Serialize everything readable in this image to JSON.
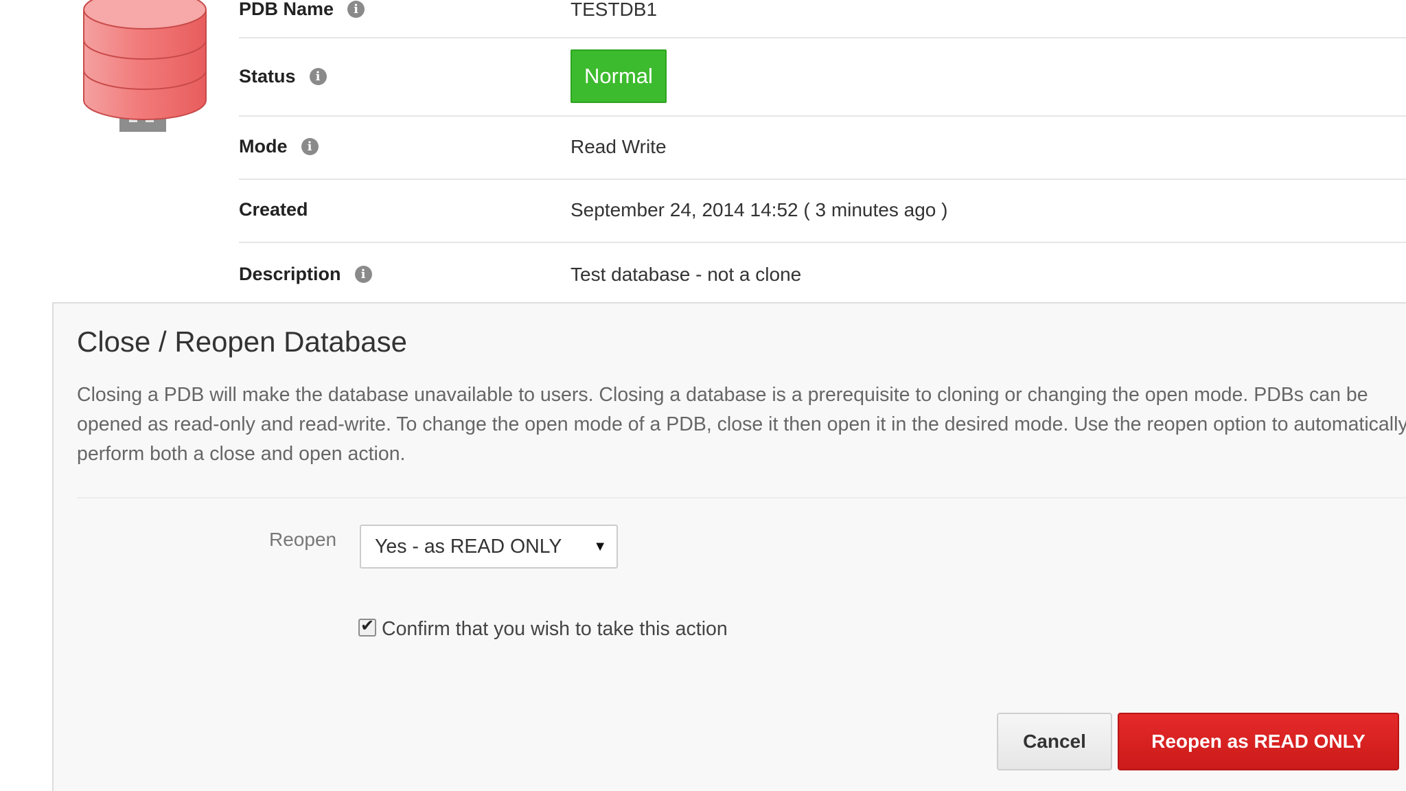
{
  "details": {
    "pdb_name": {
      "label": "PDB Name",
      "value": "TESTDB1"
    },
    "status": {
      "label": "Status",
      "value": "Normal"
    },
    "mode": {
      "label": "Mode",
      "value": "Read Write"
    },
    "created": {
      "label": "Created",
      "value": "September 24, 2014 14:52 ( 3 minutes ago )"
    },
    "description": {
      "label": "Description",
      "value": "Test database - not a clone"
    }
  },
  "dialog": {
    "title": "Close / Reopen Database",
    "description": "Closing a PDB will make the database unavailable to users. Closing a database is a prerequisite to cloning or changing the open mode. PDBs can be opened as read-only and read-write. To change the open mode of a PDB, close it then open it in the desired mode. Use the reopen option to automatically perform both a close and open action.",
    "reopen_label": "Reopen",
    "reopen_selected": "Yes - as READ ONLY",
    "confirm_label": "Confirm that you wish to take this action",
    "confirm_checked": true,
    "cancel_label": "Cancel",
    "submit_label": "Reopen as READ ONLY"
  },
  "icons": {
    "database": "database-icon",
    "info": "info-icon",
    "dropdown": "chevron-down-icon",
    "check": "checkmark-icon"
  },
  "colors": {
    "status_normal": "#3dbb2e",
    "primary_action": "#d91f1f",
    "database_icon": "#f07070"
  }
}
